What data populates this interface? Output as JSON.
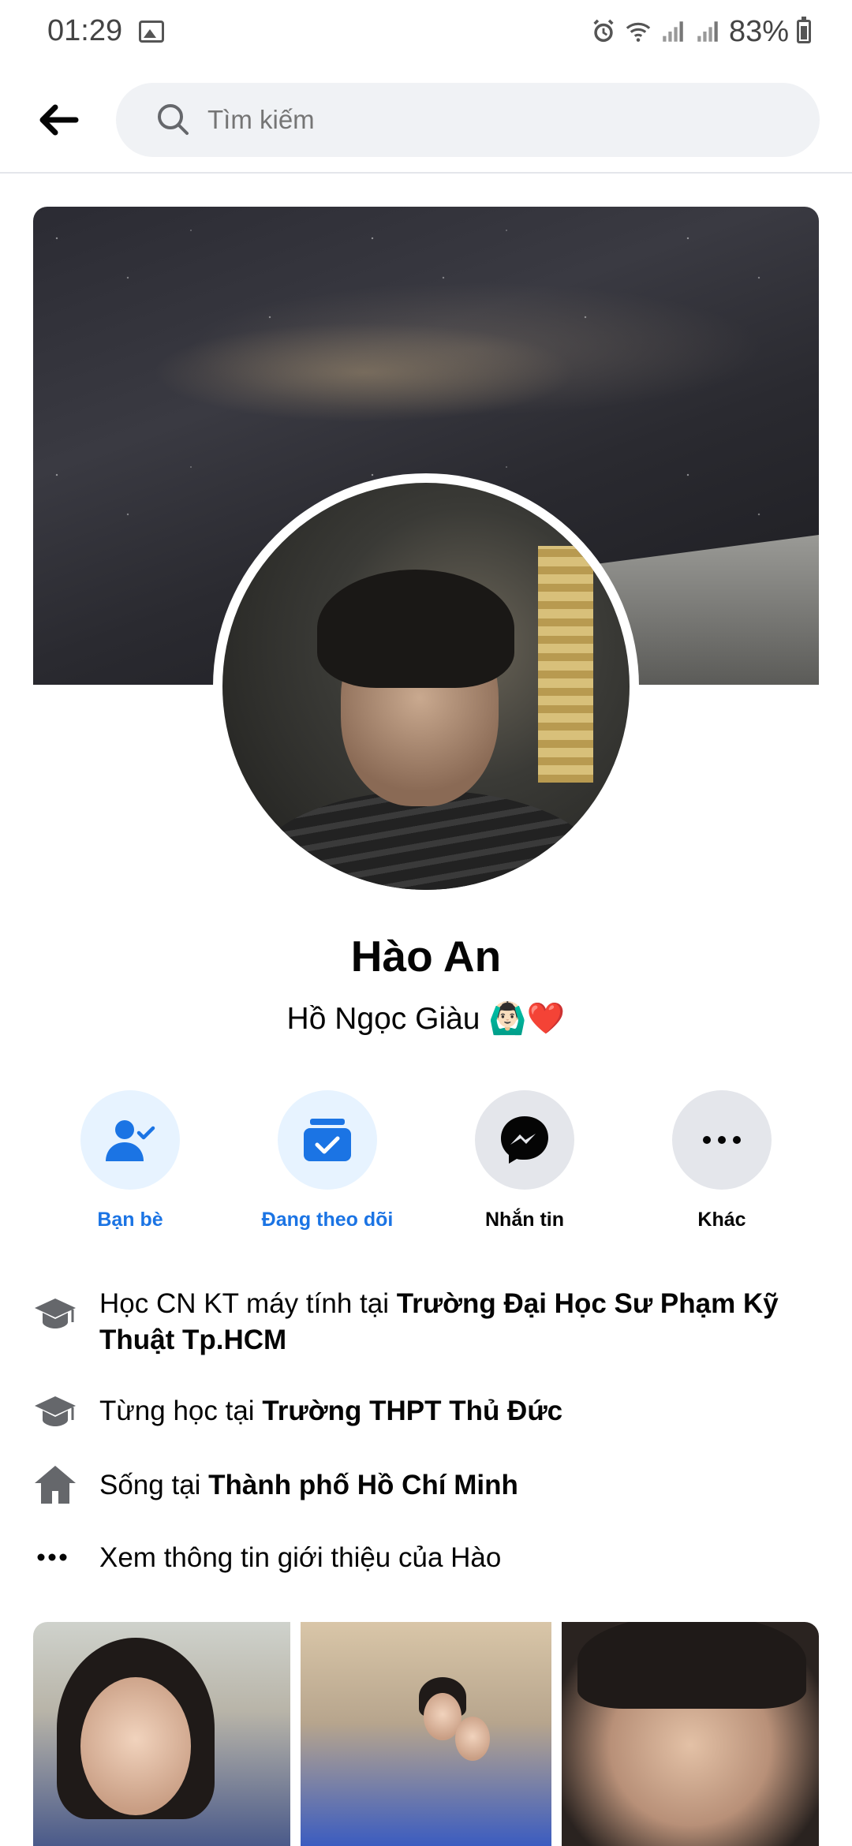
{
  "status_bar": {
    "time": "01:29",
    "battery": "83%",
    "icons": [
      "image-icon",
      "alarm-icon",
      "wifi-icon",
      "signal-icon",
      "signal-icon",
      "battery-icon"
    ]
  },
  "header": {
    "search_placeholder": "Tìm kiếm"
  },
  "profile": {
    "name": "Hào An",
    "alt_name": "Hồ Ngọc Giàu 🙆🏻‍♂️❤️"
  },
  "actions": [
    {
      "label": "Bạn bè",
      "icon": "friends-icon"
    },
    {
      "label": "Đang theo dõi",
      "icon": "following-icon"
    },
    {
      "label": "Nhắn tin",
      "icon": "messenger-icon"
    },
    {
      "label": "Khác",
      "icon": "more-icon"
    }
  ],
  "intro": {
    "study": {
      "prefix": "Học CN KT máy tính tại ",
      "place": "Trường Đại Học Sư Phạm Kỹ Thuật Tp.HCM"
    },
    "studied": {
      "prefix": "Từng học tại ",
      "place": "Trường THPT Thủ Đức"
    },
    "lives": {
      "prefix": "Sống tại ",
      "place": "Thành phố Hồ Chí Minh"
    },
    "see_more": "Xem thông tin giới thiệu của Hào"
  },
  "colors": {
    "accent": "#1b74e4",
    "accent_bg": "#e7f3ff",
    "gray_bg": "#e4e6eb",
    "search_bg": "#f0f2f5"
  }
}
